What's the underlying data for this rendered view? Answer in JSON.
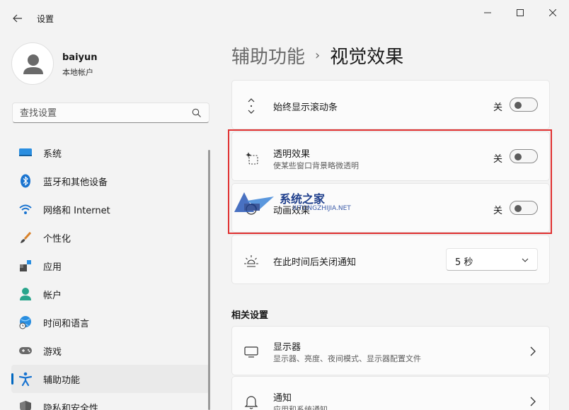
{
  "window": {
    "title": "设置"
  },
  "profile": {
    "username": "baiyun",
    "account_type": "本地帐户"
  },
  "search": {
    "placeholder": "查找设置"
  },
  "sidebar": {
    "items": [
      {
        "label": "系统",
        "icon": "system-icon"
      },
      {
        "label": "蓝牙和其他设备",
        "icon": "bluetooth-icon"
      },
      {
        "label": "网络和 Internet",
        "icon": "wifi-icon"
      },
      {
        "label": "个性化",
        "icon": "brush-icon"
      },
      {
        "label": "应用",
        "icon": "apps-icon"
      },
      {
        "label": "帐户",
        "icon": "person-icon"
      },
      {
        "label": "时间和语言",
        "icon": "globe-clock-icon"
      },
      {
        "label": "游戏",
        "icon": "gamepad-icon"
      },
      {
        "label": "辅助功能",
        "icon": "accessibility-icon",
        "active": true
      },
      {
        "label": "隐私和安全性",
        "icon": "shield-icon"
      }
    ]
  },
  "breadcrumb": {
    "parent": "辅助功能",
    "separator": "›",
    "current": "视觉效果"
  },
  "settings": {
    "scrollbars": {
      "title": "始终显示滚动条",
      "state_label": "关",
      "on": false
    },
    "transparency": {
      "title": "透明效果",
      "subtitle": "使某些窗口背景略微透明",
      "state_label": "关",
      "on": false
    },
    "animation": {
      "title": "动画效果",
      "state_label": "关",
      "on": false
    },
    "notifications": {
      "title": "在此时间后关闭通知",
      "value": "5 秒"
    }
  },
  "related": {
    "header": "相关设置",
    "items": [
      {
        "title": "显示器",
        "subtitle": "显示器、亮度、夜间模式、显示器配置文件",
        "icon": "monitor-icon"
      },
      {
        "title": "通知",
        "subtitle": "应用和系统通知",
        "icon": "bell-icon"
      }
    ]
  },
  "watermark": {
    "text": "系统之家",
    "url": "XITONGZHIJIA.NET"
  },
  "colors": {
    "accent": "#0067c0",
    "highlight_border": "#e03131",
    "background": "#f3f3f3",
    "card": "#fbfbfb"
  }
}
